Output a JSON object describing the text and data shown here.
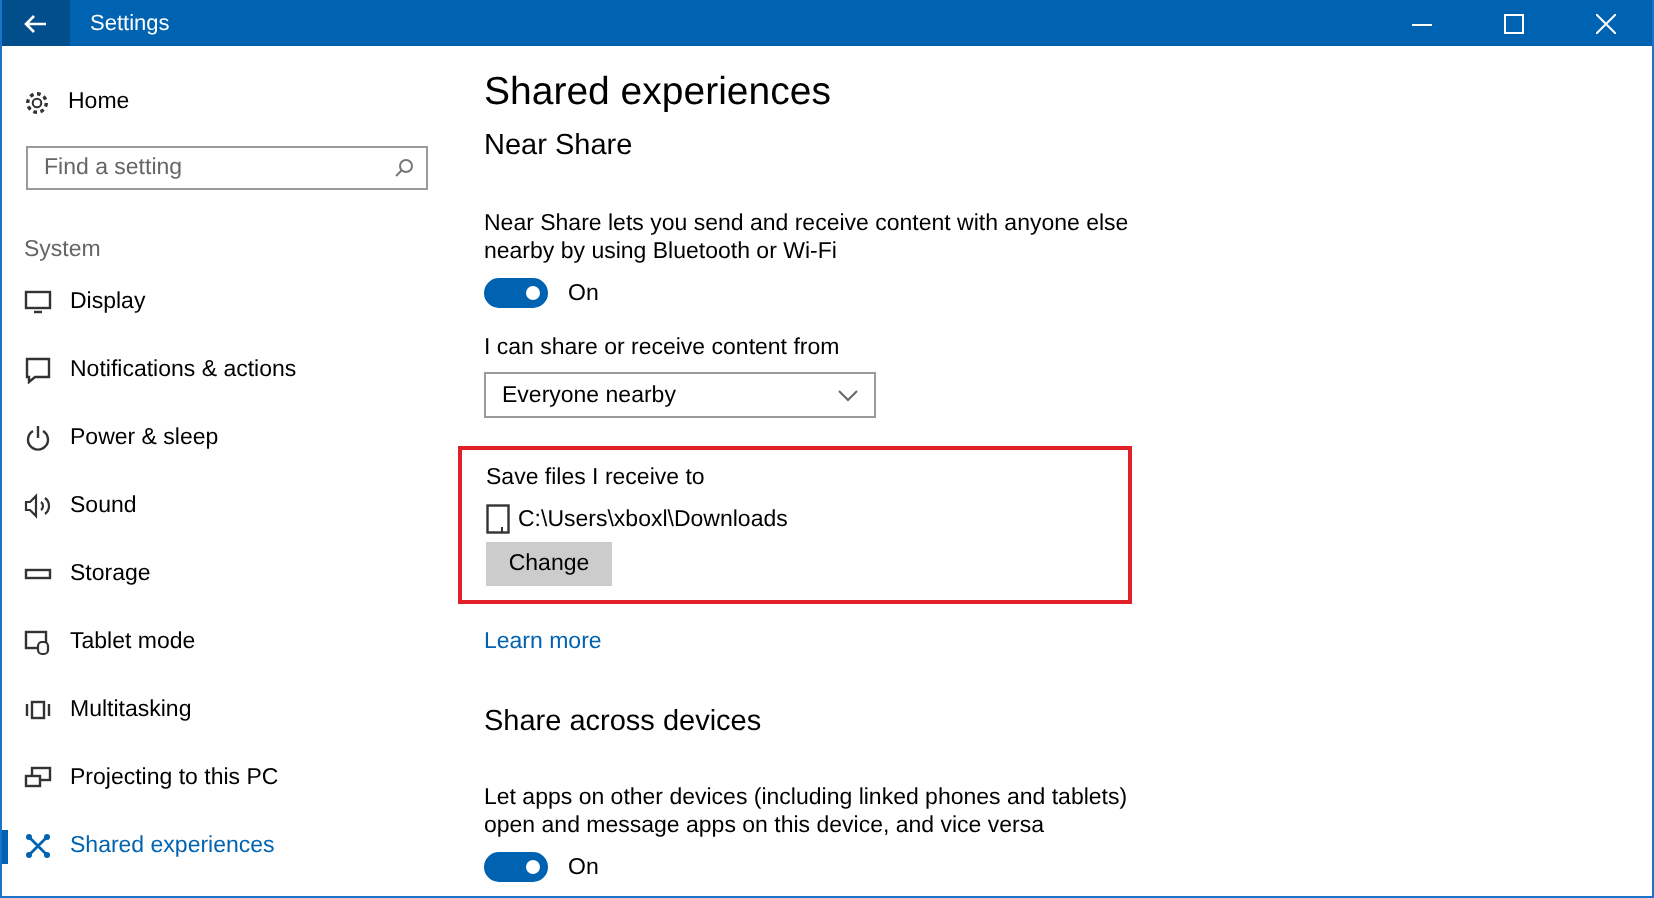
{
  "window": {
    "title": "Settings"
  },
  "sidebar": {
    "home": "Home",
    "search": {
      "placeholder": "Find a setting"
    },
    "section": "System",
    "items": [
      {
        "label": "Display",
        "selected": false
      },
      {
        "label": "Notifications & actions",
        "selected": false
      },
      {
        "label": "Power & sleep",
        "selected": false
      },
      {
        "label": "Sound",
        "selected": false
      },
      {
        "label": "Storage",
        "selected": false
      },
      {
        "label": "Tablet mode",
        "selected": false
      },
      {
        "label": "Multitasking",
        "selected": false
      },
      {
        "label": "Projecting to this PC",
        "selected": false
      },
      {
        "label": "Shared experiences",
        "selected": true
      }
    ]
  },
  "page": {
    "title": "Shared experiences",
    "near_share": {
      "heading": "Near Share",
      "description": "Near Share lets you send and receive content with anyone else nearby by using Bluetooth or Wi-Fi",
      "toggle": {
        "on": true,
        "label": "On"
      },
      "dropdown": {
        "label": "I can share or receive content from",
        "value": "Everyone nearby"
      },
      "save_location": {
        "highlighted": true,
        "label": "Save files I receive to",
        "path": "C:\\Users\\xboxl\\Downloads",
        "button": "Change"
      },
      "link": "Learn more"
    },
    "share_across_devices": {
      "heading": "Share across devices",
      "description": "Let apps on other devices (including linked phones and tablets) open and message apps on this device, and vice versa",
      "toggle": {
        "on": true,
        "label": "On"
      }
    }
  }
}
